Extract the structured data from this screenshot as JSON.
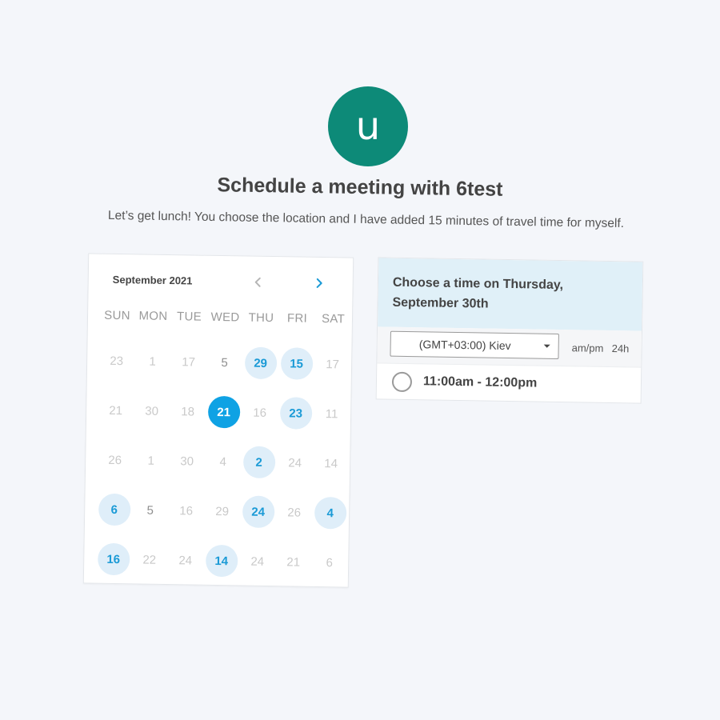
{
  "avatar": {
    "initial": "u",
    "color": "#0d8a78"
  },
  "header": {
    "title": "Schedule a meeting with 6test",
    "description": "Let’s get lunch! You choose the location and I have added 15 minutes of travel time for myself."
  },
  "calendar": {
    "month": "September 2021",
    "prev_icon": "chevron-left-icon",
    "next_icon": "chevron-right-icon",
    "weekdays": [
      "SUN",
      "MON",
      "TUE",
      "WED",
      "THU",
      "FRI",
      "SAT"
    ],
    "days": [
      {
        "label": "23",
        "state": "disabled"
      },
      {
        "label": "1",
        "state": "disabled"
      },
      {
        "label": "17",
        "state": "disabled"
      },
      {
        "label": "5",
        "state": "normal"
      },
      {
        "label": "29",
        "state": "available"
      },
      {
        "label": "15",
        "state": "available"
      },
      {
        "label": "17",
        "state": "disabled"
      },
      {
        "label": "21",
        "state": "disabled"
      },
      {
        "label": "30",
        "state": "disabled"
      },
      {
        "label": "18",
        "state": "disabled"
      },
      {
        "label": "21",
        "state": "selected"
      },
      {
        "label": "16",
        "state": "disabled"
      },
      {
        "label": "23",
        "state": "available"
      },
      {
        "label": "11",
        "state": "disabled"
      },
      {
        "label": "26",
        "state": "disabled"
      },
      {
        "label": "1",
        "state": "disabled"
      },
      {
        "label": "30",
        "state": "disabled"
      },
      {
        "label": "4",
        "state": "disabled"
      },
      {
        "label": "2",
        "state": "available"
      },
      {
        "label": "24",
        "state": "disabled"
      },
      {
        "label": "14",
        "state": "disabled"
      },
      {
        "label": "6",
        "state": "available"
      },
      {
        "label": "5",
        "state": "normal"
      },
      {
        "label": "16",
        "state": "disabled"
      },
      {
        "label": "29",
        "state": "disabled"
      },
      {
        "label": "24",
        "state": "available"
      },
      {
        "label": "26",
        "state": "disabled"
      },
      {
        "label": "4",
        "state": "available"
      },
      {
        "label": "16",
        "state": "available"
      },
      {
        "label": "22",
        "state": "disabled"
      },
      {
        "label": "24",
        "state": "disabled"
      },
      {
        "label": "14",
        "state": "available"
      },
      {
        "label": "24",
        "state": "disabled"
      },
      {
        "label": "21",
        "state": "disabled"
      },
      {
        "label": "6",
        "state": "disabled"
      }
    ]
  },
  "time_panel": {
    "title": "Choose a time on Thursday, September 30th",
    "timezone": "(GMT+03:00) Kiev",
    "format_ampm": "am/pm",
    "format_24h": "24h",
    "slots": [
      {
        "label": "11:00am - 12:00pm"
      }
    ]
  },
  "colors": {
    "accent": "#0fa2e4",
    "available_bg": "#dfeef9",
    "panel_header_bg": "#e0f0f8"
  }
}
